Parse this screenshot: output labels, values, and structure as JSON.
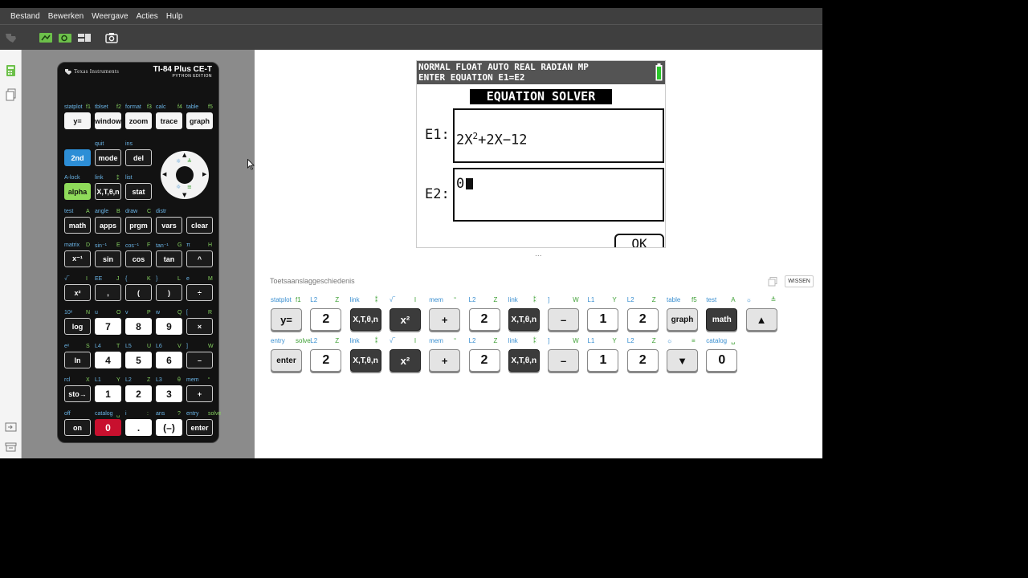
{
  "menu": [
    "Bestand",
    "Bewerken",
    "Weergave",
    "Acties",
    "Hulp"
  ],
  "calculator": {
    "brand": "Texas Instruments",
    "model": "TI-84 Plus CE-T",
    "edition": "PYTHON EDITION",
    "rows": [
      {
        "labels": [
          [
            "statplot",
            "f1"
          ],
          [
            "tblset",
            "f2"
          ],
          [
            "format",
            "f3"
          ],
          [
            "calc",
            "f4"
          ],
          [
            "table",
            "f5"
          ]
        ],
        "keys": [
          "y=",
          "window",
          "zoom",
          "trace",
          "graph"
        ]
      },
      {
        "labels": [
          [
            "",
            ""
          ],
          [
            "quit",
            ""
          ],
          [
            "ins",
            ""
          ]
        ],
        "keys": [
          "2nd",
          "mode",
          "del"
        ]
      },
      {
        "labels": [
          [
            "A-lock",
            ""
          ],
          [
            "link",
            "⁑"
          ],
          [
            "list",
            ""
          ]
        ],
        "keys": [
          "alpha",
          "X,T,θ,n",
          "stat"
        ]
      },
      {
        "labels": [
          [
            "test",
            "A"
          ],
          [
            "angle",
            "B"
          ],
          [
            "draw",
            "C"
          ],
          [
            "distr",
            ""
          ],
          [
            "",
            ""
          ]
        ],
        "keys": [
          "math",
          "apps",
          "prgm",
          "vars",
          "clear"
        ]
      },
      {
        "labels": [
          [
            "matrix",
            "D"
          ],
          [
            "sin⁻¹",
            "E"
          ],
          [
            "cos⁻¹",
            "F"
          ],
          [
            "tan⁻¹",
            "G"
          ],
          [
            "π",
            "H"
          ]
        ],
        "keys": [
          "x⁻¹",
          "sin",
          "cos",
          "tan",
          "^"
        ]
      },
      {
        "labels": [
          [
            "√‾",
            "I"
          ],
          [
            "EE",
            "J"
          ],
          [
            "{",
            "K"
          ],
          [
            "}",
            "L"
          ],
          [
            "e",
            "M"
          ]
        ],
        "keys": [
          "x²",
          ",",
          "(",
          ")",
          "÷"
        ]
      },
      {
        "labels": [
          [
            "10ˣ",
            "N"
          ],
          [
            "u",
            "O"
          ],
          [
            "v",
            "P"
          ],
          [
            "w",
            "Q"
          ],
          [
            "[",
            "R"
          ]
        ],
        "keys": [
          "log",
          "7",
          "8",
          "9",
          "×"
        ]
      },
      {
        "labels": [
          [
            "eˣ",
            "S"
          ],
          [
            "L4",
            "T"
          ],
          [
            "L5",
            "U"
          ],
          [
            "L6",
            "V"
          ],
          [
            "]",
            "W"
          ]
        ],
        "keys": [
          "ln",
          "4",
          "5",
          "6",
          "–"
        ]
      },
      {
        "labels": [
          [
            "rcl",
            "X"
          ],
          [
            "L1",
            "Y"
          ],
          [
            "L2",
            "Z"
          ],
          [
            "L3",
            "θ"
          ],
          [
            "mem",
            "“"
          ]
        ],
        "keys": [
          "sto→",
          "1",
          "2",
          "3",
          "+"
        ]
      },
      {
        "labels": [
          [
            "off",
            ""
          ],
          [
            "catalog",
            "␣"
          ],
          [
            "i",
            ":"
          ],
          [
            "ans",
            "?"
          ],
          [
            "entry",
            "solve"
          ]
        ],
        "keys": [
          "on",
          "0",
          ".",
          "(–)",
          "enter"
        ]
      }
    ]
  },
  "screen": {
    "status_line1": "NORMAL FLOAT AUTO REAL RADIAN MP",
    "status_line2": "ENTER EQUATION E1=E2",
    "title": "EQUATION SOLVER",
    "e1_label": "E1:",
    "e1_base": "2X",
    "e1_exp": "2",
    "e1_rest": "+2X−12",
    "e2_label": "E2:",
    "e2_value": "0",
    "ok_label": "OK"
  },
  "history": {
    "title": "Toetsaanslaggeschiedenis",
    "clear_label": "WISSEN",
    "handle": "...",
    "row1": [
      {
        "key": "y=",
        "l": "statplot",
        "r": "f1",
        "style": "hg"
      },
      {
        "key": "2",
        "l": "L2",
        "r": "Z",
        "style": "hw"
      },
      {
        "key": "X,T,θ,n",
        "l": "link",
        "r": "⁑",
        "style": "hd"
      },
      {
        "key": "x²",
        "l": "√‾",
        "r": "I",
        "style": "hd"
      },
      {
        "key": "+",
        "l": "mem",
        "r": "“",
        "style": "hg"
      },
      {
        "key": "2",
        "l": "L2",
        "r": "Z",
        "style": "hw"
      },
      {
        "key": "X,T,θ,n",
        "l": "link",
        "r": "⁑",
        "style": "hd"
      },
      {
        "key": "–",
        "l": "]",
        "r": "W",
        "style": "hg"
      },
      {
        "key": "1",
        "l": "L1",
        "r": "Y",
        "style": "hw"
      },
      {
        "key": "2",
        "l": "L2",
        "r": "Z",
        "style": "hw"
      },
      {
        "key": "graph",
        "l": "table",
        "r": "f5",
        "style": "hg"
      },
      {
        "key": "math",
        "l": "test",
        "r": "A",
        "style": "hd"
      },
      {
        "key": "▲",
        "l": "☼",
        "r": "≜",
        "style": "hg"
      }
    ],
    "row2": [
      {
        "key": "enter",
        "l": "entry",
        "r": "solve",
        "style": "hg"
      },
      {
        "key": "2",
        "l": "L2",
        "r": "Z",
        "style": "hw"
      },
      {
        "key": "X,T,θ,n",
        "l": "link",
        "r": "⁑",
        "style": "hd"
      },
      {
        "key": "x²",
        "l": "√‾",
        "r": "I",
        "style": "hd"
      },
      {
        "key": "+",
        "l": "mem",
        "r": "“",
        "style": "hg"
      },
      {
        "key": "2",
        "l": "L2",
        "r": "Z",
        "style": "hw"
      },
      {
        "key": "X,T,θ,n",
        "l": "link",
        "r": "⁑",
        "style": "hd"
      },
      {
        "key": "–",
        "l": "]",
        "r": "W",
        "style": "hg"
      },
      {
        "key": "1",
        "l": "L1",
        "r": "Y",
        "style": "hw"
      },
      {
        "key": "2",
        "l": "L2",
        "r": "Z",
        "style": "hw"
      },
      {
        "key": "▼",
        "l": "☼",
        "r": "≡",
        "style": "hg"
      },
      {
        "key": "0",
        "l": "catalog",
        "r": "␣",
        "style": "hw"
      }
    ]
  }
}
